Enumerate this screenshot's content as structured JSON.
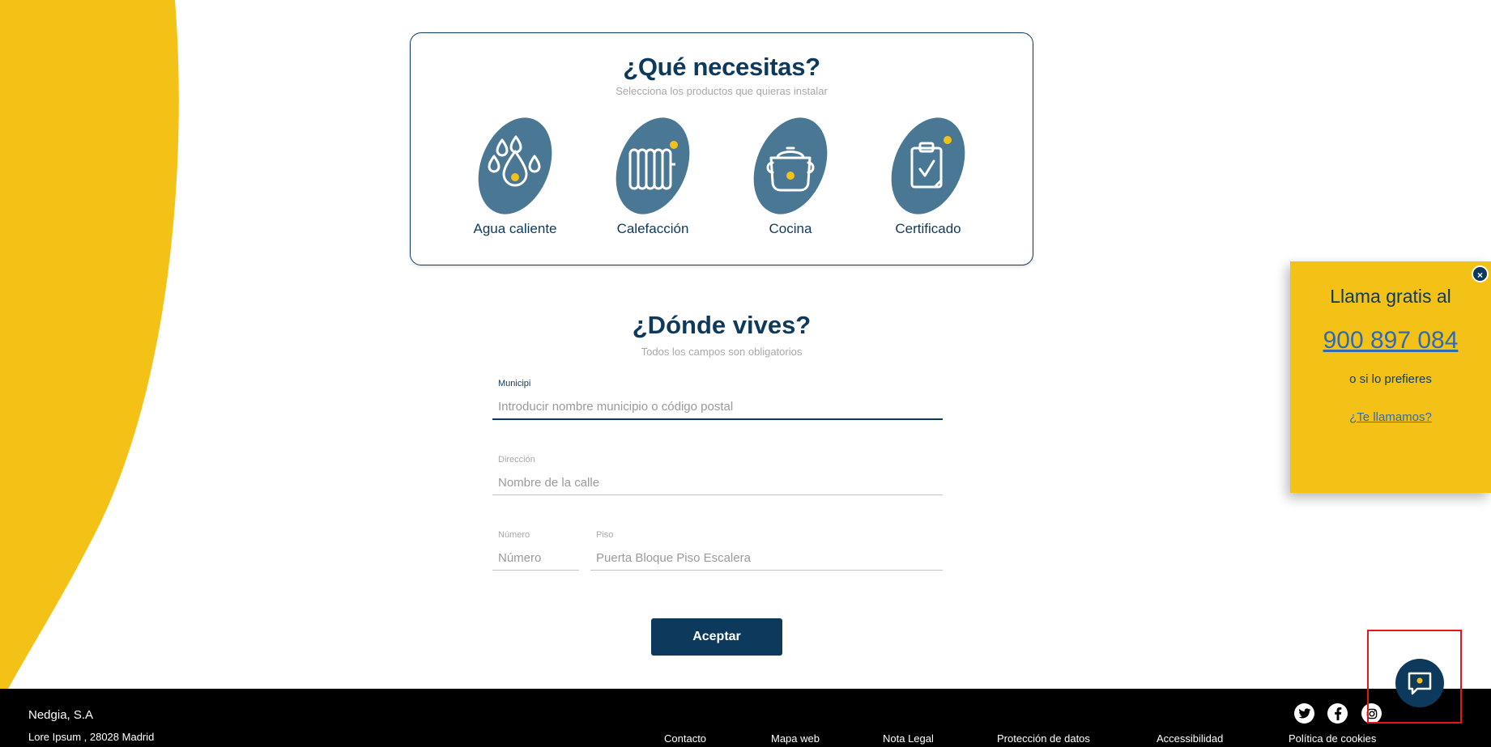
{
  "products_section": {
    "title": "¿Qué necesitas?",
    "subtitle": "Selecciona los productos que quieras instalar",
    "items": [
      {
        "label": "Agua caliente",
        "icon": "water-drops-icon"
      },
      {
        "label": "Calefacción",
        "icon": "radiator-icon"
      },
      {
        "label": "Cocina",
        "icon": "cooking-pot-icon"
      },
      {
        "label": "Certificado",
        "icon": "clipboard-check-icon"
      }
    ]
  },
  "address_section": {
    "title": "¿Dónde vives?",
    "subtitle": "Todos los campos son obligatorios",
    "municipio": {
      "label": "Municipi",
      "placeholder": "Introducir nombre municipio o código postal"
    },
    "direccion": {
      "label": "Dirección",
      "placeholder": "Nombre de la calle"
    },
    "numero": {
      "label": "Número",
      "placeholder": "Número"
    },
    "piso": {
      "label": "Piso",
      "placeholder": "Puerta Bloque Piso Escalera"
    },
    "submit_label": "Aceptar"
  },
  "call_panel": {
    "title": "Llama gratis al",
    "phone": "900 897 084",
    "or_text": "o si lo prefieres",
    "callback_link": "¿Te llamamos?",
    "close_label": "×"
  },
  "footer": {
    "company": "Nedgia, S.A",
    "address": "Lore Ipsum , 28028 Madrid",
    "links": [
      "Contacto",
      "Mapa web",
      "Nota Legal",
      "Protección de datos",
      "Accessibilidad",
      "Política de cookies"
    ],
    "social": [
      "twitter-icon",
      "facebook-icon",
      "instagram-icon"
    ]
  },
  "colors": {
    "primary": "#0d3a5c",
    "accent_yellow": "#f4c217",
    "icon_blob": "#4a7894",
    "link_blue": "#2f6ab3"
  }
}
